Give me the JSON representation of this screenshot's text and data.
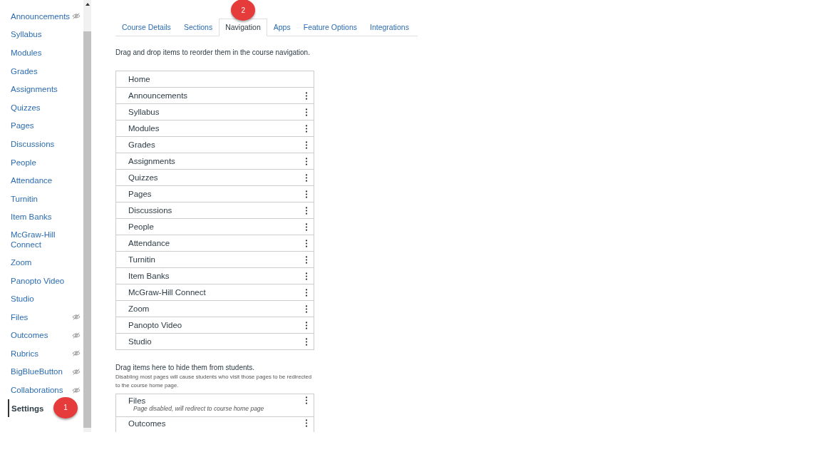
{
  "sidebar": {
    "items": [
      {
        "label": "Announcements",
        "hidden": true,
        "selected": false
      },
      {
        "label": "Syllabus",
        "hidden": false,
        "selected": false
      },
      {
        "label": "Modules",
        "hidden": false,
        "selected": false
      },
      {
        "label": "Grades",
        "hidden": false,
        "selected": false
      },
      {
        "label": "Assignments",
        "hidden": false,
        "selected": false
      },
      {
        "label": "Quizzes",
        "hidden": false,
        "selected": false
      },
      {
        "label": "Pages",
        "hidden": false,
        "selected": false
      },
      {
        "label": "Discussions",
        "hidden": false,
        "selected": false
      },
      {
        "label": "People",
        "hidden": false,
        "selected": false
      },
      {
        "label": "Attendance",
        "hidden": false,
        "selected": false
      },
      {
        "label": "Turnitin",
        "hidden": false,
        "selected": false
      },
      {
        "label": "Item Banks",
        "hidden": false,
        "selected": false
      },
      {
        "label": "McGraw-Hill Connect",
        "hidden": false,
        "selected": false
      },
      {
        "label": "Zoom",
        "hidden": false,
        "selected": false
      },
      {
        "label": "Panopto Video",
        "hidden": false,
        "selected": false
      },
      {
        "label": "Studio",
        "hidden": false,
        "selected": false
      },
      {
        "label": "Files",
        "hidden": true,
        "selected": false
      },
      {
        "label": "Outcomes",
        "hidden": true,
        "selected": false
      },
      {
        "label": "Rubrics",
        "hidden": true,
        "selected": false
      },
      {
        "label": "BigBlueButton",
        "hidden": true,
        "selected": false
      },
      {
        "label": "Collaborations",
        "hidden": true,
        "selected": false
      },
      {
        "label": "Settings",
        "hidden": false,
        "selected": true,
        "badge": "1"
      }
    ]
  },
  "tabs": [
    {
      "label": "Course Details",
      "selected": false
    },
    {
      "label": "Sections",
      "selected": false
    },
    {
      "label": "Navigation",
      "selected": true,
      "badge": "2"
    },
    {
      "label": "Apps",
      "selected": false
    },
    {
      "label": "Feature Options",
      "selected": false
    },
    {
      "label": "Integrations",
      "selected": false
    }
  ],
  "instructions": "Drag and drop items to reorder them in the course navigation.",
  "enabled_items": [
    {
      "label": "Home",
      "menu": false
    },
    {
      "label": "Announcements",
      "menu": true
    },
    {
      "label": "Syllabus",
      "menu": true
    },
    {
      "label": "Modules",
      "menu": true
    },
    {
      "label": "Grades",
      "menu": true
    },
    {
      "label": "Assignments",
      "menu": true
    },
    {
      "label": "Quizzes",
      "menu": true
    },
    {
      "label": "Pages",
      "menu": true
    },
    {
      "label": "Discussions",
      "menu": true
    },
    {
      "label": "People",
      "menu": true
    },
    {
      "label": "Attendance",
      "menu": true
    },
    {
      "label": "Turnitin",
      "menu": true
    },
    {
      "label": "Item Banks",
      "menu": true
    },
    {
      "label": "McGraw-Hill Connect",
      "menu": true
    },
    {
      "label": "Zoom",
      "menu": true
    },
    {
      "label": "Panopto Video",
      "menu": true
    },
    {
      "label": "Studio",
      "menu": true
    }
  ],
  "hidden_heading": "Drag items here to hide them from students.",
  "hidden_note": "Disabling most pages will cause students who visit those pages to be redirected to the course home page.",
  "disabled_items": [
    {
      "label": "Files",
      "note": "Page disabled, will redirect to course home page",
      "menu": true
    },
    {
      "label": "Outcomes",
      "menu": true
    }
  ]
}
